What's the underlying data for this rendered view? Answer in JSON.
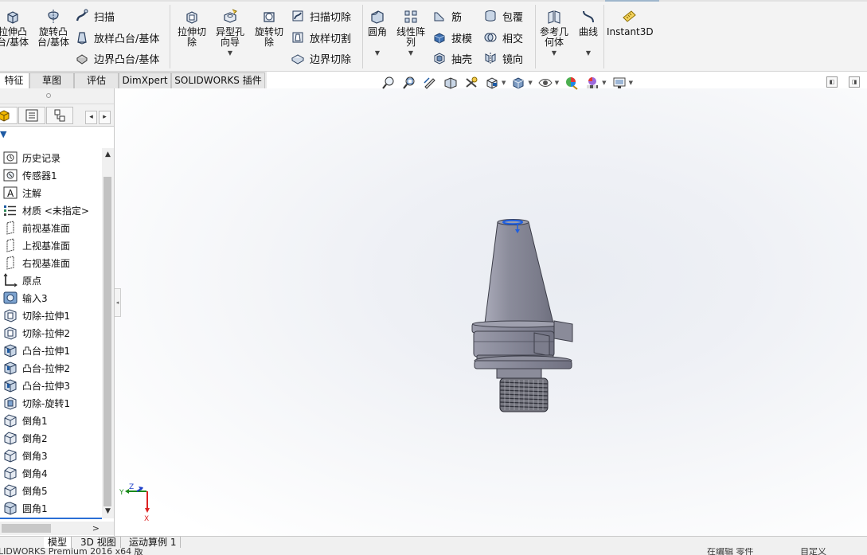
{
  "command_manager": {
    "big_buttons": [
      {
        "label": "拉伸凸\n台/基体",
        "icon": "extruded-boss-icon"
      },
      {
        "label": "旋转凸\n台/基体",
        "icon": "revolved-boss-icon"
      },
      {
        "label": "拉伸切\n除",
        "icon": "extruded-cut-icon"
      },
      {
        "label": "异型孔\n向导",
        "icon": "hole-wizard-icon"
      },
      {
        "label": "旋转切\n除",
        "icon": "revolved-cut-icon"
      },
      {
        "label": "圆角",
        "icon": "fillet-icon"
      },
      {
        "label": "线性阵\n列",
        "icon": "linear-pattern-icon"
      },
      {
        "label": "参考几\n何体",
        "icon": "reference-geometry-icon"
      },
      {
        "label": "曲线",
        "icon": "curves-icon"
      },
      {
        "label": "Instant3D",
        "icon": "instant3d-icon"
      }
    ],
    "small_buttons": [
      {
        "label": "扫描",
        "icon": "swept-boss-icon"
      },
      {
        "label": "放样凸台/基体",
        "icon": "lofted-boss-icon"
      },
      {
        "label": "边界凸台/基体",
        "icon": "boundary-boss-icon"
      },
      {
        "label": "扫描切除",
        "icon": "swept-cut-icon"
      },
      {
        "label": "放样切割",
        "icon": "lofted-cut-icon"
      },
      {
        "label": "边界切除",
        "icon": "boundary-cut-icon"
      },
      {
        "label": "筋",
        "icon": "rib-icon"
      },
      {
        "label": "拔模",
        "icon": "draft-icon"
      },
      {
        "label": "抽壳",
        "icon": "shell-icon"
      },
      {
        "label": "包覆",
        "icon": "wrap-icon"
      },
      {
        "label": "相交",
        "icon": "intersect-icon"
      },
      {
        "label": "镜向",
        "icon": "mirror-icon"
      }
    ]
  },
  "tabs": [
    {
      "label": "特征",
      "active": true
    },
    {
      "label": "草图"
    },
    {
      "label": "评估"
    },
    {
      "label": "DimXpert"
    },
    {
      "label": "SOLIDWORKS 插件"
    }
  ],
  "feature_tree": {
    "items": [
      {
        "label": "历史记录",
        "icon": "history-icon"
      },
      {
        "label": "传感器1",
        "icon": "sensor-icon"
      },
      {
        "label": "注解",
        "icon": "annotations-icon"
      },
      {
        "label": "材质 <未指定>",
        "icon": "material-icon"
      },
      {
        "label": "前视基准面",
        "icon": "plane-icon"
      },
      {
        "label": "上视基准面",
        "icon": "plane-icon"
      },
      {
        "label": "右视基准面",
        "icon": "plane-icon"
      },
      {
        "label": "原点",
        "icon": "origin-icon"
      },
      {
        "label": "输入3",
        "icon": "imported-body-icon"
      },
      {
        "label": "切除-拉伸1",
        "icon": "cut-extrude-icon"
      },
      {
        "label": "切除-拉伸2",
        "icon": "cut-extrude-icon"
      },
      {
        "label": "凸台-拉伸1",
        "icon": "boss-extrude-icon"
      },
      {
        "label": "凸台-拉伸2",
        "icon": "boss-extrude-icon"
      },
      {
        "label": "凸台-拉伸3",
        "icon": "boss-extrude-icon"
      },
      {
        "label": "切除-旋转1",
        "icon": "cut-revolve-icon"
      },
      {
        "label": "倒角1",
        "icon": "chamfer-icon"
      },
      {
        "label": "倒角2",
        "icon": "chamfer-icon"
      },
      {
        "label": "倒角3",
        "icon": "chamfer-icon"
      },
      {
        "label": "倒角4",
        "icon": "chamfer-icon"
      },
      {
        "label": "倒角5",
        "icon": "chamfer-icon"
      },
      {
        "label": "圆角1",
        "icon": "fillet-feature-icon"
      }
    ]
  },
  "triad": {
    "z": "Z",
    "y": "Y",
    "x": "X"
  },
  "bottom_tabs": [
    {
      "label": "模型",
      "active": true
    },
    {
      "label": "3D 视图"
    },
    {
      "label": "运动算例 1"
    }
  ],
  "status": {
    "product": "LIDWORKS Premium 2016 x64 版",
    "mode": "在编辑 零件",
    "units": "自定义"
  },
  "colors": {
    "accent_blue": "#2b6fd6",
    "model_gray": "#8a8b99",
    "background": "#ffffff"
  }
}
